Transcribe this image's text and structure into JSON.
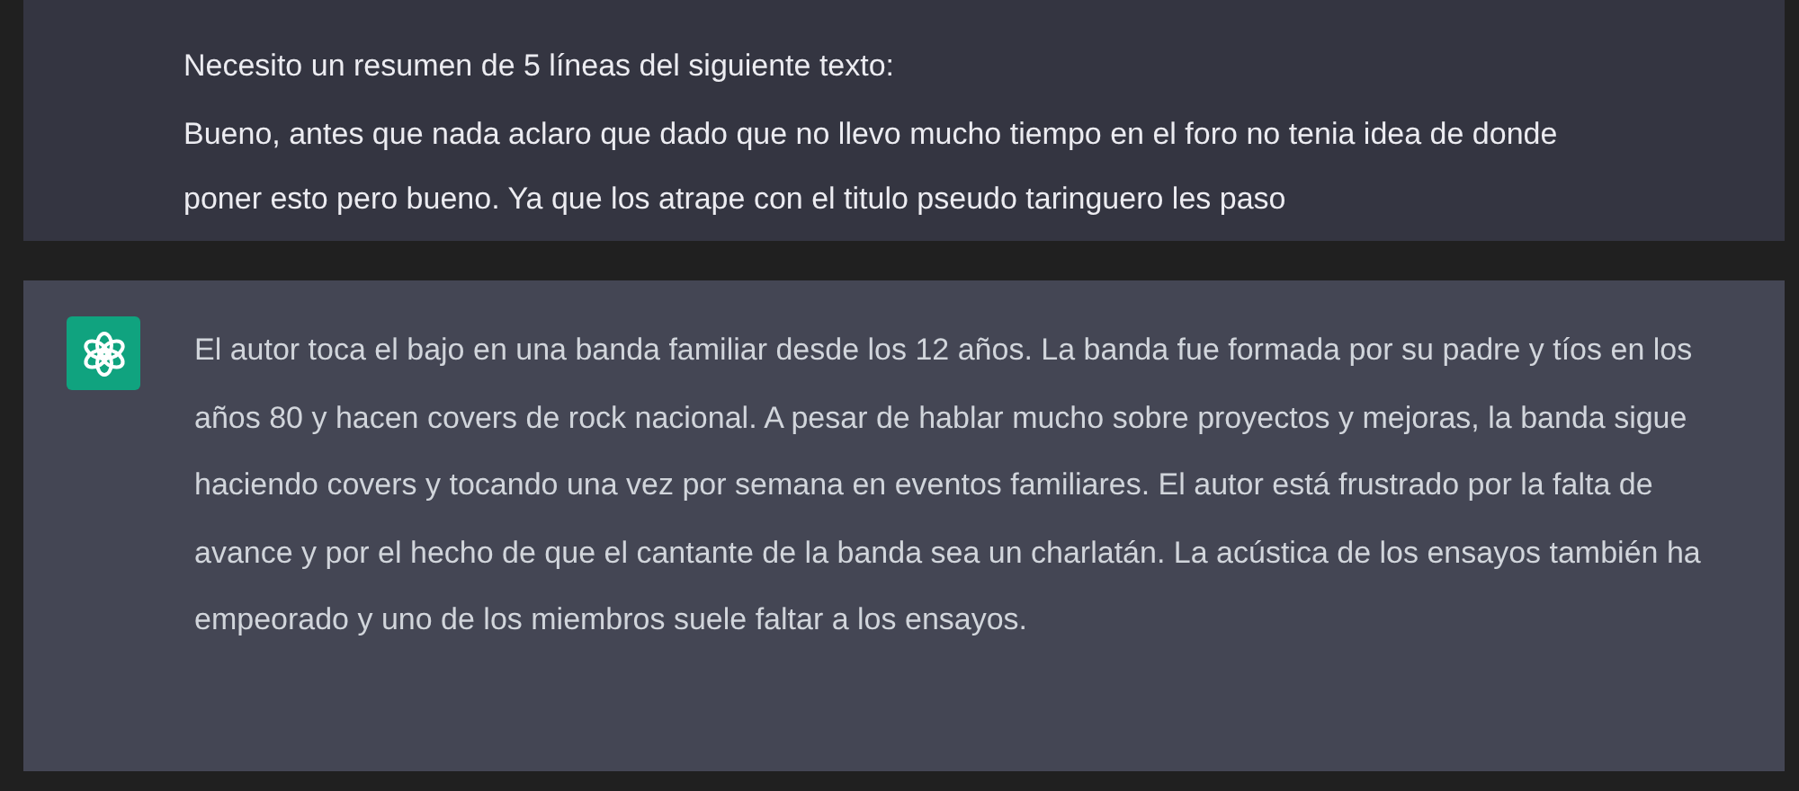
{
  "messages": [
    {
      "kind": "user",
      "paragraphs": [
        "Necesito un resumen de 5 líneas del siguiente texto:",
        "Bueno, antes que nada aclaro que dado que no llevo mucho tiempo en el foro no tenia idea de donde poner esto pero bueno. Ya que los atrape con el titulo pseudo taringuero les paso"
      ]
    },
    {
      "kind": "assistant",
      "paragraphs": [
        "El autor toca el bajo en una banda familiar desde los 12 años. La banda fue formada por su padre y tíos en los años 80 y hacen covers de rock nacional. A pesar de hablar mucho sobre proyectos y mejoras, la banda sigue haciendo covers y tocando una vez por semana en eventos familiares. El autor está frustrado por la falta de avance y por el hecho de que el cantante de la banda sea un charlatán. La acústica de los ensayos también ha empeorado y uno de los miembros suele faltar a los ensayos."
      ]
    }
  ]
}
